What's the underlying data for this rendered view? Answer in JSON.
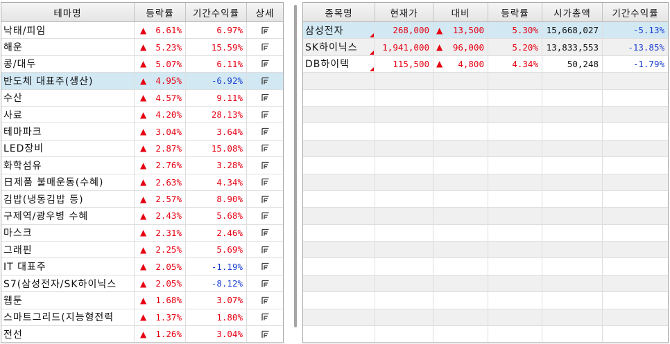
{
  "theme_table": {
    "headers": {
      "name": "테마명",
      "change_rate": "등락률",
      "period_return": "기간수익률",
      "detail": "상세"
    },
    "detail_icon": "detail-icon",
    "rows": [
      {
        "name": "낙태/피임",
        "arrow": "▲",
        "change_rate": "6.61%",
        "period_return": "6.97%"
      },
      {
        "name": "해운",
        "arrow": "▲",
        "change_rate": "5.23%",
        "period_return": "15.59%"
      },
      {
        "name": "콩/대두",
        "arrow": "▲",
        "change_rate": "5.07%",
        "period_return": "6.11%"
      },
      {
        "name": "반도체 대표주(생산)",
        "arrow": "▲",
        "change_rate": "4.95%",
        "period_return": "-6.92%",
        "selected": true
      },
      {
        "name": "수산",
        "arrow": "▲",
        "change_rate": "4.57%",
        "period_return": "9.11%"
      },
      {
        "name": "사료",
        "arrow": "▲",
        "change_rate": "4.20%",
        "period_return": "28.13%"
      },
      {
        "name": "테마파크",
        "arrow": "▲",
        "change_rate": "3.04%",
        "period_return": "3.64%"
      },
      {
        "name": "LED장비",
        "arrow": "▲",
        "change_rate": "2.87%",
        "period_return": "15.08%"
      },
      {
        "name": "화학섬유",
        "arrow": "▲",
        "change_rate": "2.76%",
        "period_return": "3.28%"
      },
      {
        "name": "日제품 불매운동(수혜)",
        "arrow": "▲",
        "change_rate": "2.63%",
        "period_return": "4.34%"
      },
      {
        "name": "김밥(냉동김밥 등)",
        "arrow": "▲",
        "change_rate": "2.57%",
        "period_return": "8.90%"
      },
      {
        "name": "구제역/광우병 수혜",
        "arrow": "▲",
        "change_rate": "2.43%",
        "period_return": "5.68%"
      },
      {
        "name": "마스크",
        "arrow": "▲",
        "change_rate": "2.31%",
        "period_return": "2.46%"
      },
      {
        "name": "그래핀",
        "arrow": "▲",
        "change_rate": "2.25%",
        "period_return": "5.69%"
      },
      {
        "name": "IT 대표주",
        "arrow": "▲",
        "change_rate": "2.05%",
        "period_return": "-1.19%"
      },
      {
        "name": "S7(삼성전자/SK하이닉스",
        "arrow": "▲",
        "change_rate": "2.05%",
        "period_return": "-8.12%"
      },
      {
        "name": "웹툰",
        "arrow": "▲",
        "change_rate": "1.68%",
        "period_return": "3.07%"
      },
      {
        "name": "스마트그리드(지능형전력",
        "arrow": "▲",
        "change_rate": "1.37%",
        "period_return": "1.80%"
      },
      {
        "name": "전선",
        "arrow": "▲",
        "change_rate": "1.26%",
        "period_return": "3.04%"
      }
    ]
  },
  "stock_table": {
    "headers": {
      "name": "종목명",
      "price": "현재가",
      "change": "대비",
      "change_rate": "등락률",
      "market_cap": "시가총액",
      "period_return": "기간수익률"
    },
    "rows": [
      {
        "name": "삼성전자",
        "price": "268,000",
        "arrow": "▲",
        "change": "13,500",
        "change_rate": "5.30%",
        "market_cap": "15,668,027",
        "period_return": "-5.13%",
        "selected": true,
        "marker": true
      },
      {
        "name": "SK하이닉스",
        "price": "1,941,000",
        "arrow": "▲",
        "change": "96,000",
        "change_rate": "5.20%",
        "market_cap": "13,833,553",
        "period_return": "-13.85%",
        "marker": true
      },
      {
        "name": "DB하이텍",
        "price": "115,500",
        "arrow": "▲",
        "change": "4,800",
        "change_rate": "4.34%",
        "market_cap": "50,248",
        "period_return": "-1.79%",
        "marker": true
      }
    ]
  },
  "colors": {
    "up": "#e60012",
    "down": "#1a3fd0",
    "neutral": "#111111",
    "selected_row": "#d2e9f4",
    "stripe_row": "#f0f0f0",
    "marker": "#e60012",
    "icon": "#3a3a3a"
  }
}
